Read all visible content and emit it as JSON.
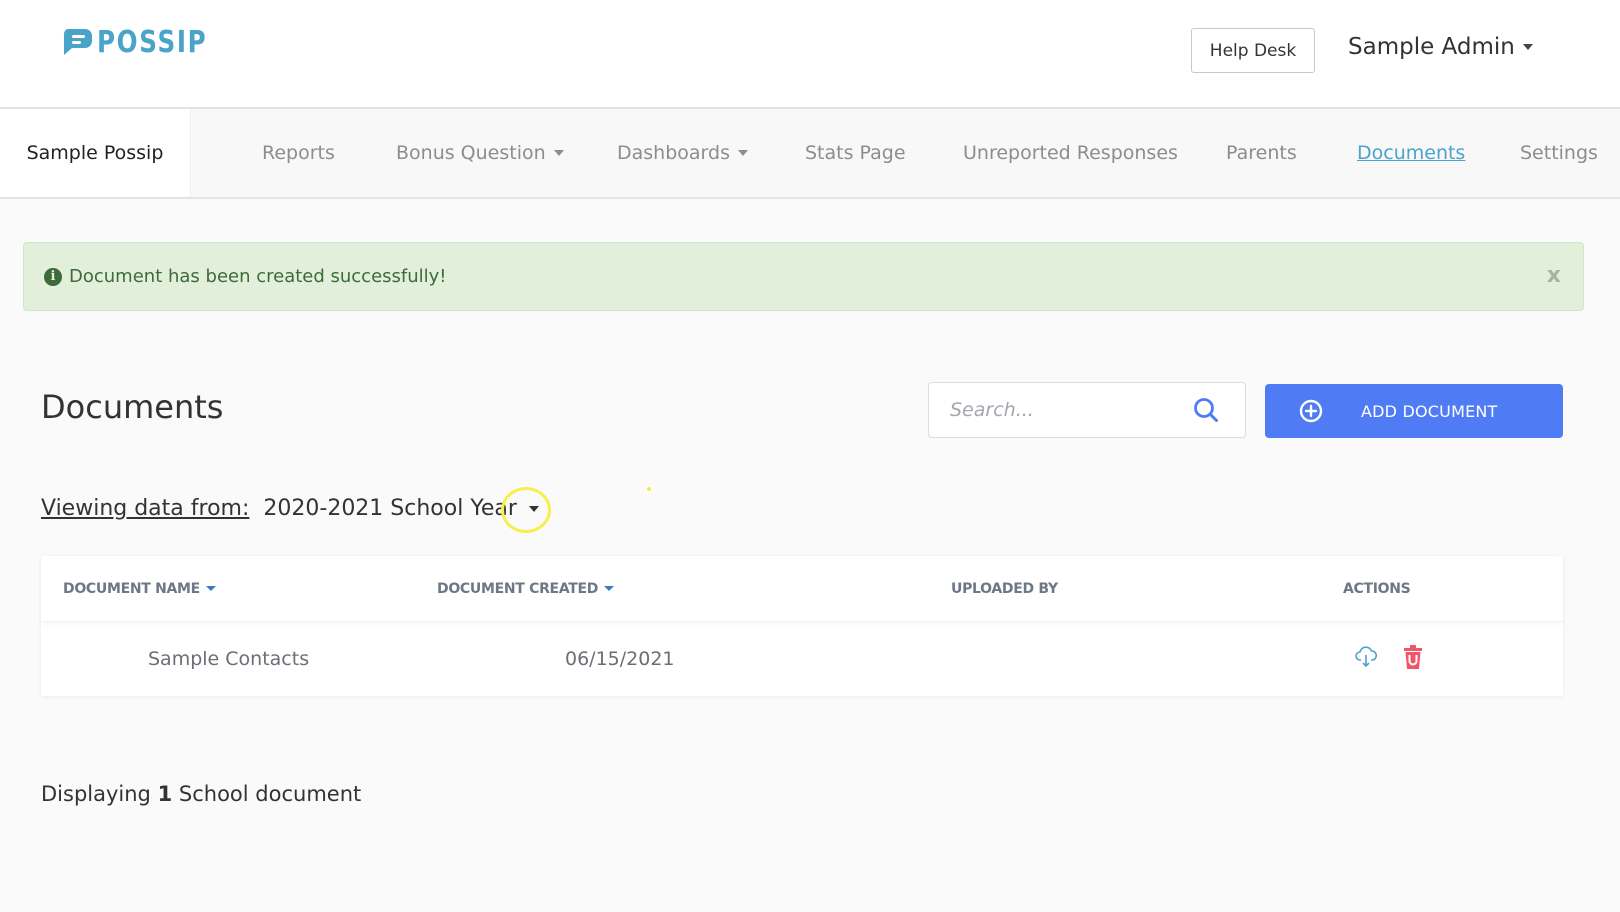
{
  "header": {
    "logo_text": "POSSIP",
    "help_desk_label": "Help Desk",
    "user_name": "Sample Admin"
  },
  "nav": {
    "brand": "Sample Possip",
    "items": [
      {
        "label": "Reports",
        "dropdown": false
      },
      {
        "label": "Bonus Question",
        "dropdown": true
      },
      {
        "label": "Dashboards",
        "dropdown": true
      },
      {
        "label": "Stats Page",
        "dropdown": false
      },
      {
        "label": "Unreported Responses",
        "dropdown": false
      },
      {
        "label": "Parents",
        "dropdown": false
      },
      {
        "label": "Documents",
        "dropdown": false,
        "active": true
      },
      {
        "label": "Settings",
        "dropdown": false
      }
    ]
  },
  "alert": {
    "message": "Document has been created successfully!",
    "close_label": "x",
    "icon": "info-circle-icon"
  },
  "page": {
    "title": "Documents",
    "search_placeholder": "Search...",
    "search_value": "",
    "add_button_label": "ADD DOCUMENT",
    "viewing_label": "Viewing data from:",
    "selected_year": "2020-2021 School Year"
  },
  "table": {
    "columns": [
      {
        "label": "DOCUMENT NAME",
        "sortable": true
      },
      {
        "label": "DOCUMENT CREATED",
        "sortable": true
      },
      {
        "label": "UPLOADED BY",
        "sortable": false
      },
      {
        "label": "ACTIONS",
        "sortable": false
      }
    ],
    "rows": [
      {
        "name": "Sample Contacts",
        "created": "06/15/2021",
        "uploaded_by": "",
        "actions": [
          "download-cloud-icon",
          "trash-icon"
        ]
      }
    ]
  },
  "footer": {
    "prefix": "Displaying",
    "count": "1",
    "suffix": "School document"
  },
  "colors": {
    "brand": "#4aa3c8",
    "primary_button": "#4f7cf4",
    "alert_bg": "#e1efdb",
    "alert_text": "#3d6b3a",
    "delete": "#f0566a",
    "download": "#4aa3c8"
  }
}
